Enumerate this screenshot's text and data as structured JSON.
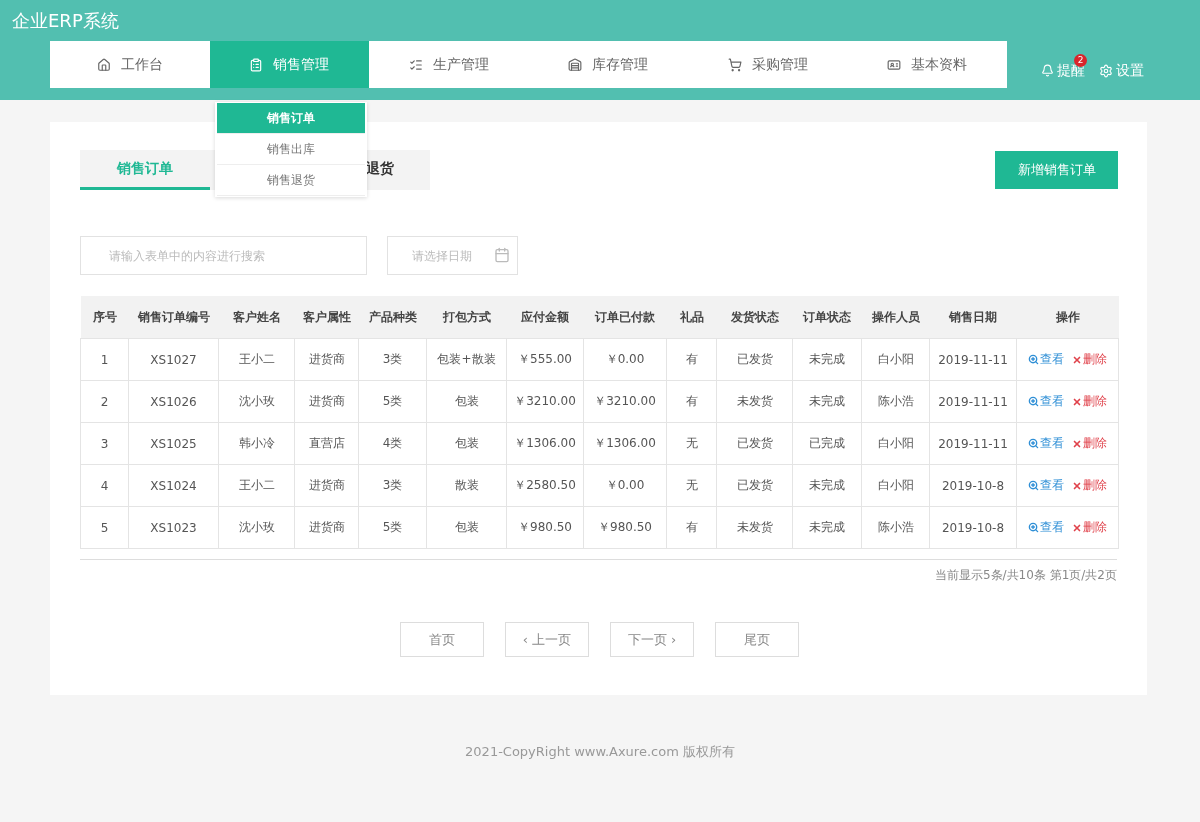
{
  "app_title": "企业ERP系统",
  "nav": [
    {
      "label": "工作台",
      "selected": false
    },
    {
      "label": "销售管理",
      "selected": true
    },
    {
      "label": "生产管理",
      "selected": false
    },
    {
      "label": "库存管理",
      "selected": false
    },
    {
      "label": "采购管理",
      "selected": false
    },
    {
      "label": "基本资料",
      "selected": false
    }
  ],
  "header_actions": {
    "reminder": {
      "label": "提醒",
      "badge": "2"
    },
    "settings": {
      "label": "设置"
    }
  },
  "dropdown": [
    {
      "label": "销售订单",
      "selected": true
    },
    {
      "label": "销售出库",
      "selected": false
    },
    {
      "label": "销售退货",
      "selected": false
    }
  ],
  "tabs": [
    {
      "label": "销售订单",
      "selected": true
    },
    {
      "label": "退货",
      "selected": false
    }
  ],
  "new_button": "新增销售订单",
  "search": {
    "placeholder": "请输入表单中的内容进行搜索"
  },
  "date_picker": {
    "placeholder": "请选择日期"
  },
  "table": {
    "columns": [
      "序号",
      "销售订单编号",
      "客户姓名",
      "客户属性",
      "产品种类",
      "打包方式",
      "应付金额",
      "订单已付款",
      "礼品",
      "发货状态",
      "订单状态",
      "操作人员",
      "销售日期",
      "操作"
    ],
    "rows": [
      {
        "cells": [
          "1",
          "XS1027",
          "王小二",
          "进货商",
          "3类",
          "包装+散装",
          "￥555.00",
          "￥0.00",
          "有",
          "已发货",
          "未完成",
          "白小阳",
          "2019-11-11"
        ],
        "actions": [
          {
            "kind": "view",
            "label": "查看"
          },
          {
            "kind": "delete",
            "label": "删除"
          }
        ]
      },
      {
        "cells": [
          "2",
          "XS1026",
          "沈小玫",
          "进货商",
          "5类",
          "包装",
          "￥3210.00",
          "￥3210.00",
          "有",
          "未发货",
          "未完成",
          "陈小浩",
          "2019-11-11"
        ],
        "actions": [
          {
            "kind": "view",
            "label": "查看"
          },
          {
            "kind": "delete",
            "label": "删除"
          }
        ]
      },
      {
        "cells": [
          "3",
          "XS1025",
          "韩小冷",
          "直营店",
          "4类",
          "包装",
          "￥1306.00",
          "￥1306.00",
          "无",
          "已发货",
          "已完成",
          "白小阳",
          "2019-11-11"
        ],
        "actions": [
          {
            "kind": "view",
            "label": "查看"
          },
          {
            "kind": "delete",
            "label": "删除"
          }
        ]
      },
      {
        "cells": [
          "4",
          "XS1024",
          "王小二",
          "进货商",
          "3类",
          "散装",
          "￥2580.50",
          "￥0.00",
          "无",
          "已发货",
          "未完成",
          "白小阳",
          "2019-10-8"
        ],
        "actions": [
          {
            "kind": "view",
            "label": "查看"
          },
          {
            "kind": "delete",
            "label": "删除"
          }
        ]
      },
      {
        "cells": [
          "5",
          "XS1023",
          "沈小玫",
          "进货商",
          "5类",
          "包装",
          "￥980.50",
          "￥980.50",
          "有",
          "未发货",
          "未完成",
          "陈小浩",
          "2019-10-8"
        ],
        "actions": [
          {
            "kind": "view",
            "label": "查看"
          },
          {
            "kind": "delete",
            "label": "删除"
          }
        ]
      }
    ]
  },
  "pagination_info": "当前显示5条/共10条 第1页/共2页",
  "pager": [
    "首页",
    "‹ 上一页",
    "下一页 ›",
    "尾页"
  ],
  "footer": "2021-CopyRight www.Axure.com 版权所有"
}
